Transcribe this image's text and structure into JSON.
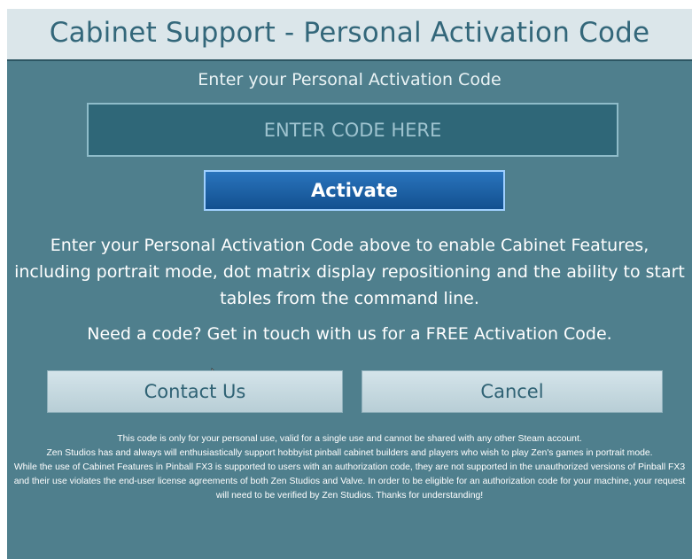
{
  "dialog": {
    "title": "Cabinet Support - Personal Activation Code",
    "prompt": "Enter your Personal Activation Code",
    "code_input": {
      "value": "",
      "placeholder": "ENTER CODE HERE"
    },
    "activate_label": "Activate",
    "description": "Enter your Personal Activation Code above to enable Cabinet Features, including portrait mode, dot matrix display repositioning and the ability to start tables from the command line.",
    "need_code": "Need a code? Get in touch with us for a FREE Activation Code.",
    "contact_label": "Contact Us",
    "cancel_label": "Cancel",
    "disclaimer": {
      "line1": "This code is only for your personal use, valid for a single use and cannot be shared with any other Steam account.",
      "line2": "Zen Studios has and always will enthusiastically support hobbyist pinball cabinet builders and players who wish to play Zen's games in portrait mode.",
      "line3": "While the use of Cabinet Features in Pinball FX3 is supported to users with an authorization code, they are not supported in the unauthorized versions of Pinball FX3 and their use violates the end-user license agreements of both Zen Studios and Valve. In order to be eligible for an authorization code for your machine, your request will need to be verified by Zen Studios. Thanks for understanding!"
    }
  },
  "colors": {
    "panel": "#4f7f8d",
    "title_bar": "#dbe6ea",
    "title_text": "#33677a",
    "activate_button": "#1a5fa3",
    "light_button": "#c9dce3"
  },
  "icons": {
    "cursor": "mouse-cursor-icon"
  }
}
